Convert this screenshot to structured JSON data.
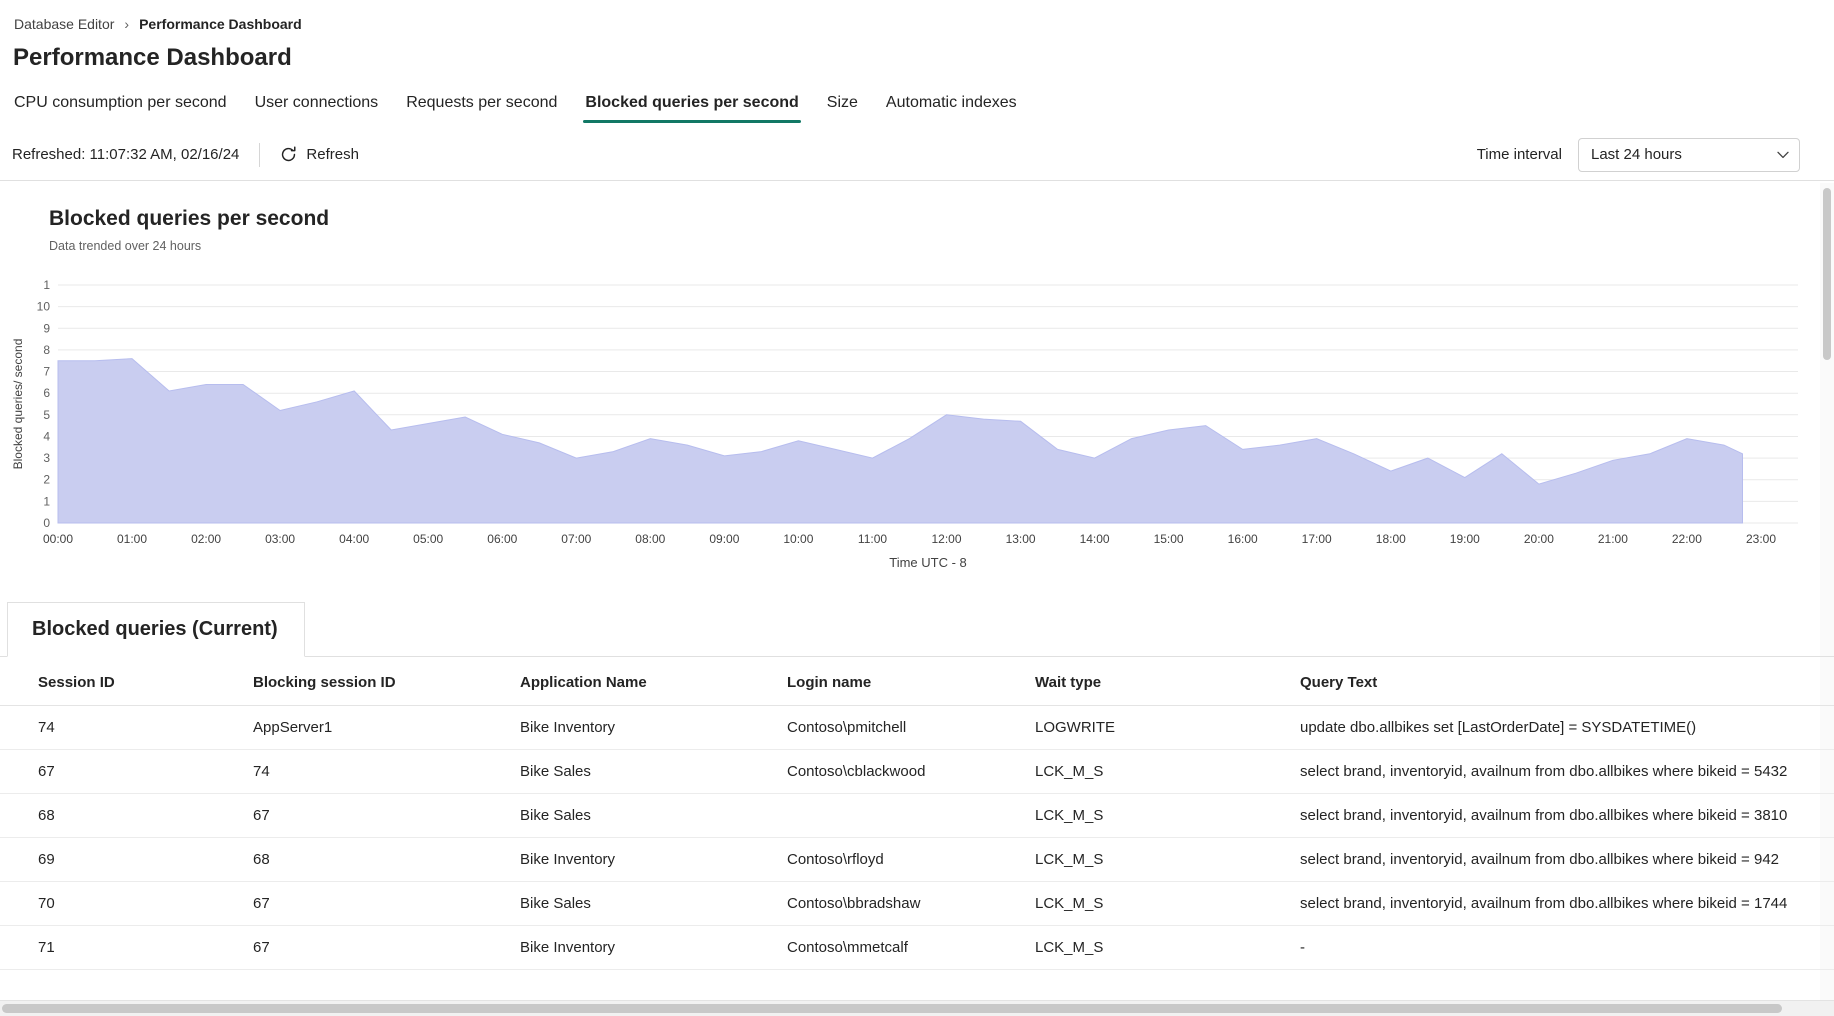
{
  "breadcrumb": {
    "separator": "›",
    "items": [
      {
        "label": "Database Editor"
      },
      {
        "label": "Performance Dashboard"
      }
    ]
  },
  "page": {
    "title": "Performance Dashboard"
  },
  "tabs": [
    {
      "label": "CPU consumption per second",
      "active": false
    },
    {
      "label": "User connections",
      "active": false
    },
    {
      "label": "Requests per second",
      "active": false
    },
    {
      "label": "Blocked queries per second",
      "active": true
    },
    {
      "label": "Size",
      "active": false
    },
    {
      "label": "Automatic indexes",
      "active": false
    }
  ],
  "toolbar": {
    "refreshed_text": "Refreshed: 11:07:32 AM, 02/16/24",
    "refresh_label": "Refresh",
    "time_interval_label": "Time interval",
    "time_interval_value": "Last 24 hours"
  },
  "chart": {
    "title": "Blocked queries per second",
    "subtitle": "Data trended over 24 hours"
  },
  "chart_data": {
    "type": "area",
    "title": "Blocked queries per second",
    "xlabel": "Time UTC - 8",
    "ylabel": "Blocked queries/ second",
    "ylim": [
      0,
      11
    ],
    "grid": "horizontal",
    "legend": "none",
    "fill_color": "#c9cdf0",
    "stroke_color": "#b7bdee",
    "y_tick_labels_bottom_to_top": [
      "0",
      "1",
      "2",
      "3",
      "4",
      "5",
      "6",
      "7",
      "8",
      "9",
      "10",
      "1"
    ],
    "x_tick_labels": [
      "00:00",
      "01:00",
      "02:00",
      "03:00",
      "04:00",
      "05:00",
      "06:00",
      "07:00",
      "08:00",
      "09:00",
      "10:00",
      "11:00",
      "12:00",
      "13:00",
      "14:00",
      "15:00",
      "16:00",
      "17:00",
      "18:00",
      "19:00",
      "20:00",
      "21:00",
      "22:00",
      "23:00"
    ],
    "x_hours": [
      0,
      0.5,
      1,
      1.5,
      2,
      2.5,
      3,
      3.5,
      4,
      4.5,
      5,
      5.5,
      6,
      6.5,
      7,
      7.5,
      8,
      8.5,
      9,
      9.5,
      10,
      10.5,
      11,
      11.5,
      12,
      12.5,
      13,
      13.5,
      14,
      14.5,
      15,
      15.5,
      16,
      16.5,
      17,
      17.5,
      18,
      18.5,
      19,
      19.5,
      20,
      20.5,
      21,
      21.5,
      22,
      22.5,
      22.75
    ],
    "values": [
      7.5,
      7.5,
      7.6,
      6.1,
      6.4,
      6.4,
      5.2,
      5.6,
      6.1,
      4.3,
      4.6,
      4.9,
      4.1,
      3.7,
      3.0,
      3.3,
      3.9,
      3.6,
      3.1,
      3.3,
      3.8,
      3.4,
      3.0,
      3.9,
      5.0,
      4.8,
      4.7,
      3.4,
      3.0,
      3.9,
      4.3,
      4.5,
      3.4,
      3.6,
      3.9,
      3.2,
      2.4,
      3.0,
      2.1,
      3.2,
      1.8,
      2.3,
      2.9,
      3.2,
      3.9,
      3.6,
      3.2
    ]
  },
  "table": {
    "title": "Blocked queries (Current)",
    "columns": [
      "Session ID",
      "Blocking session ID",
      "Application Name",
      "Login name",
      "Wait type",
      "Query Text"
    ],
    "rows": [
      [
        "74",
        "AppServer1",
        "Bike Inventory",
        "Contoso\\pmitchell",
        "LOGWRITE",
        "update dbo.allbikes set [LastOrderDate] = SYSDATETIME()"
      ],
      [
        "67",
        "74",
        "Bike Sales",
        "Contoso\\cblackwood",
        "LCK_M_S",
        "select brand, inventoryid, availnum from dbo.allbikes where bikeid = 5432"
      ],
      [
        "68",
        "67",
        "Bike Sales",
        "",
        "LCK_M_S",
        "select brand, inventoryid, availnum from dbo.allbikes where bikeid = 3810"
      ],
      [
        "69",
        "68",
        "Bike Inventory",
        "Contoso\\rfloyd",
        "LCK_M_S",
        "select brand, inventoryid, availnum from dbo.allbikes where bikeid = 942"
      ],
      [
        "70",
        "67",
        "Bike Sales",
        "Contoso\\bbradshaw",
        "LCK_M_S",
        "select brand, inventoryid, availnum from dbo.allbikes where bikeid = 1744"
      ],
      [
        "71",
        "67",
        "Bike Inventory",
        "Contoso\\mmetcalf",
        "LCK_M_S",
        "-"
      ]
    ]
  },
  "colors": {
    "accent": "#117865",
    "chart_fill": "#c9cdf0",
    "grid_line": "#e9e9e9",
    "border": "#e0e0e0",
    "secondary_text": "#616161"
  }
}
